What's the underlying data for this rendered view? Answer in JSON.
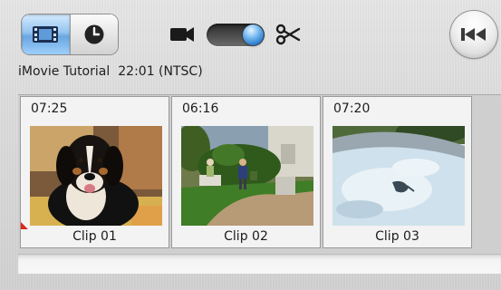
{
  "toolbar": {
    "view_toggle": {
      "options": [
        {
          "name": "clip-view",
          "icon": "film-strip-icon",
          "selected": true
        },
        {
          "name": "timeline-view",
          "icon": "clock-icon",
          "selected": false
        }
      ]
    },
    "mode_switch": {
      "left_icon": "camera-icon",
      "right_icon": "scissors-icon",
      "position": "edit"
    },
    "rewind_icon": "rewind-to-start-icon"
  },
  "project": {
    "title": "iMovie Tutorial",
    "duration": "22:01 (NTSC)"
  },
  "clips": [
    {
      "duration": "07:25",
      "name": "Clip 01"
    },
    {
      "duration": "06:16",
      "name": "Clip 02"
    },
    {
      "duration": "07:20",
      "name": "Clip 03"
    }
  ],
  "colors": {
    "accent_blue": "#4a90d9",
    "marker_red": "#d92a1c"
  }
}
